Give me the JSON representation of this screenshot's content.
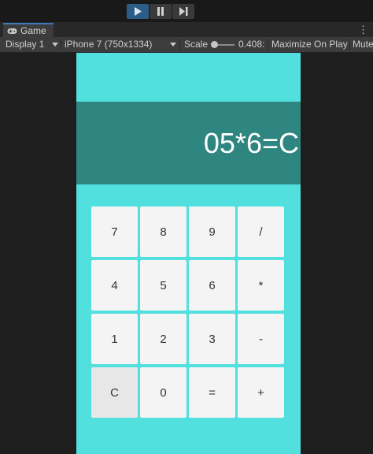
{
  "toolbar": {
    "play_icon": "play-icon",
    "pause_icon": "pause-icon",
    "step_icon": "step-icon"
  },
  "tab": {
    "label": "Game",
    "icon": "gamepad-icon"
  },
  "game_toolbar": {
    "display": "Display 1",
    "resolution": "iPhone 7 (750x1334)",
    "scale_label": "Scale",
    "scale_value": "0.408:",
    "maximize": "Maximize On Play",
    "mute": "Mute"
  },
  "calculator": {
    "display": "05*6=C",
    "keys": [
      "7",
      "8",
      "9",
      "/",
      "4",
      "5",
      "6",
      "*",
      "1",
      "2",
      "3",
      "-",
      "C",
      "0",
      "=",
      "+"
    ]
  },
  "colors": {
    "accent": "#3a79bb",
    "screen_bg": "#52e0de",
    "display_bg": "#2f8580",
    "key_bg": "#f4f4f4"
  }
}
